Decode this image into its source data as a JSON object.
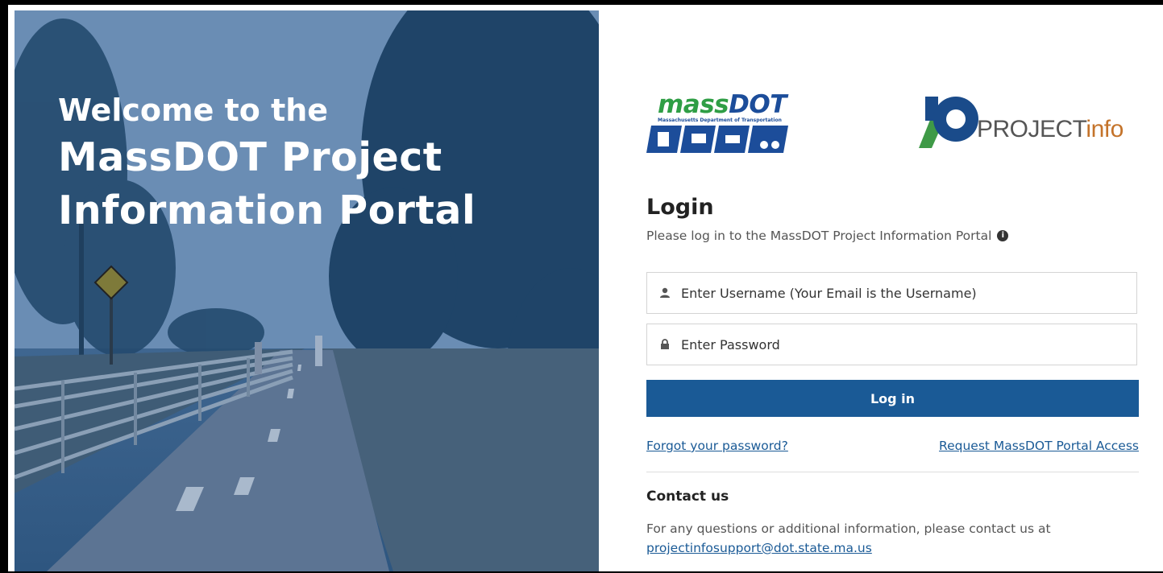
{
  "hero": {
    "line1": "Welcome to the",
    "line2": "MassDOT Project",
    "line3": "Information Portal"
  },
  "logos": {
    "massdot_word_a": "mass",
    "massdot_word_b": "DOT",
    "massdot_subtitle": "Massachusetts Department of Transportation",
    "projectinfo_a": "PROJECT",
    "projectinfo_b": "info"
  },
  "login": {
    "title": "Login",
    "subtitle": "Please log in to the MassDOT Project Information Portal",
    "username_placeholder": "Enter Username (Your Email is the Username)",
    "password_placeholder": "Enter Password",
    "button": "Log in",
    "forgot": "Forgot your password?",
    "request": "Request MassDOT Portal Access"
  },
  "contact": {
    "title": "Contact us",
    "text": "For any questions or additional information, please contact us at",
    "email": "projectinfosupport@dot.state.ma.us"
  },
  "colors": {
    "primary": "#1a5a96",
    "massdot_green": "#2f9e45",
    "massdot_blue": "#1c4d9a",
    "projectinfo_orange": "#c4732a"
  }
}
